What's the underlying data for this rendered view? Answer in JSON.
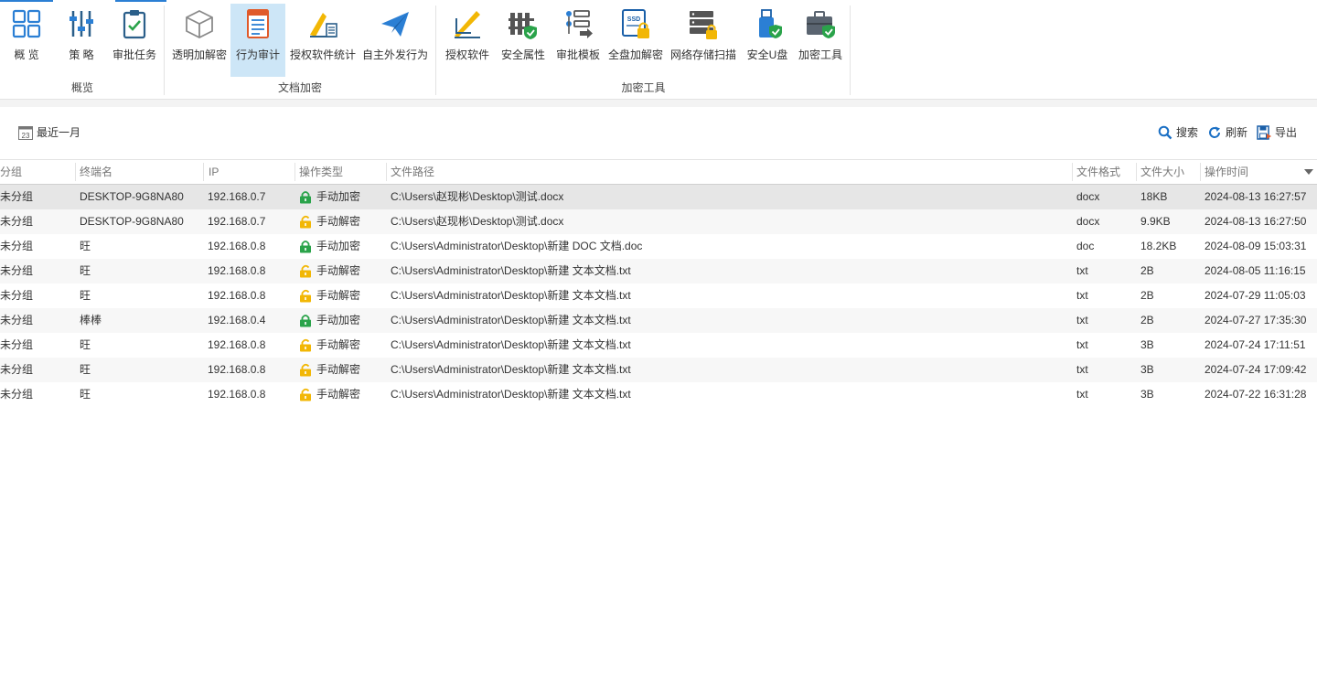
{
  "ribbon": {
    "groups": [
      {
        "label": "概览",
        "buttons": [
          {
            "label": "概 览",
            "icon": "overview-grid-icon"
          },
          {
            "label": "策 略",
            "icon": "policy-sliders-icon"
          },
          {
            "label": "审批任务",
            "icon": "approval-clipboard-icon"
          }
        ]
      },
      {
        "label": "文档加密",
        "buttons": [
          {
            "label": "透明加解密",
            "icon": "transparent-cube-icon"
          },
          {
            "label": "行为审计",
            "icon": "audit-document-icon",
            "active": true
          },
          {
            "label": "授权软件统计",
            "icon": "software-stats-icon"
          },
          {
            "label": "自主外发行为",
            "icon": "send-plane-icon"
          }
        ]
      },
      {
        "label": "加密工具",
        "buttons": [
          {
            "label": "授权软件",
            "icon": "authorized-software-icon"
          },
          {
            "label": "安全属性",
            "icon": "security-attribute-icon"
          },
          {
            "label": "审批模板",
            "icon": "approval-template-icon"
          },
          {
            "label": "全盘加解密",
            "icon": "ssd-lock-icon"
          },
          {
            "label": "网络存储扫描",
            "icon": "network-storage-icon"
          },
          {
            "label": "安全U盘",
            "icon": "secure-usb-icon"
          },
          {
            "label": "加密工具",
            "icon": "toolbox-shield-icon"
          }
        ]
      }
    ]
  },
  "toolbar": {
    "date_range": "最近一月",
    "calendar_day": "23",
    "search": "搜索",
    "refresh": "刷新",
    "export": "导出"
  },
  "table": {
    "columns": [
      "分组",
      "终端名",
      "IP",
      "操作类型",
      "文件路径",
      "文件格式",
      "文件大小",
      "操作时间"
    ],
    "rows": [
      {
        "group": "未分组",
        "terminal": "DESKTOP-9G8NA80",
        "ip": "192.168.0.7",
        "op": "手动加密",
        "lock": "locked",
        "path": "C:\\Users\\赵现彬\\Desktop\\测试.docx",
        "format": "docx",
        "size": "18KB",
        "time": "2024-08-13 16:27:57"
      },
      {
        "group": "未分组",
        "terminal": "DESKTOP-9G8NA80",
        "ip": "192.168.0.7",
        "op": "手动解密",
        "lock": "unlocked",
        "path": "C:\\Users\\赵现彬\\Desktop\\测试.docx",
        "format": "docx",
        "size": "9.9KB",
        "time": "2024-08-13 16:27:50"
      },
      {
        "group": "未分组",
        "terminal": "旺",
        "ip": "192.168.0.8",
        "op": "手动加密",
        "lock": "locked",
        "path": "C:\\Users\\Administrator\\Desktop\\新建 DOC 文档.doc",
        "format": "doc",
        "size": "18.2KB",
        "time": "2024-08-09 15:03:31"
      },
      {
        "group": "未分组",
        "terminal": "旺",
        "ip": "192.168.0.8",
        "op": "手动解密",
        "lock": "unlocked",
        "path": "C:\\Users\\Administrator\\Desktop\\新建 文本文档.txt",
        "format": "txt",
        "size": "2B",
        "time": "2024-08-05 11:16:15"
      },
      {
        "group": "未分组",
        "terminal": "旺",
        "ip": "192.168.0.8",
        "op": "手动解密",
        "lock": "unlocked",
        "path": "C:\\Users\\Administrator\\Desktop\\新建 文本文档.txt",
        "format": "txt",
        "size": "2B",
        "time": "2024-07-29 11:05:03"
      },
      {
        "group": "未分组",
        "terminal": "棒棒",
        "ip": "192.168.0.4",
        "op": "手动加密",
        "lock": "locked",
        "path": "C:\\Users\\Administrator\\Desktop\\新建 文本文档.txt",
        "format": "txt",
        "size": "2B",
        "time": "2024-07-27 17:35:30"
      },
      {
        "group": "未分组",
        "terminal": "旺",
        "ip": "192.168.0.8",
        "op": "手动解密",
        "lock": "unlocked",
        "path": "C:\\Users\\Administrator\\Desktop\\新建 文本文档.txt",
        "format": "txt",
        "size": "3B",
        "time": "2024-07-24 17:11:51"
      },
      {
        "group": "未分组",
        "terminal": "旺",
        "ip": "192.168.0.8",
        "op": "手动解密",
        "lock": "unlocked",
        "path": "C:\\Users\\Administrator\\Desktop\\新建 文本文档.txt",
        "format": "txt",
        "size": "3B",
        "time": "2024-07-24 17:09:42"
      },
      {
        "group": "未分组",
        "terminal": "旺",
        "ip": "192.168.0.8",
        "op": "手动解密",
        "lock": "unlocked",
        "path": "C:\\Users\\Administrator\\Desktop\\新建 文本文档.txt",
        "format": "txt",
        "size": "3B",
        "time": "2024-07-22 16:31:28"
      }
    ],
    "selected_row": 0
  },
  "colors": {
    "accent": "#2b7fd4",
    "active_button": "#cde6f7",
    "lock_locked": "#2aa34a",
    "lock_unlocked": "#f2b705"
  }
}
